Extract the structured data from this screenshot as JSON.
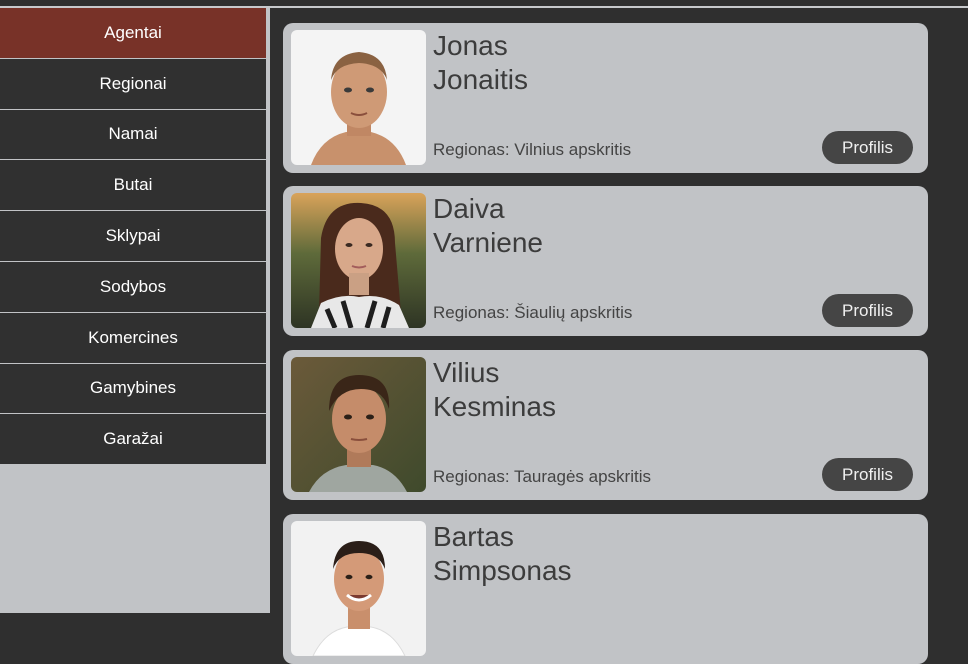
{
  "sidebar": {
    "items": [
      {
        "label": "Agentai",
        "active": true
      },
      {
        "label": "Regionai"
      },
      {
        "label": "Namai"
      },
      {
        "label": "Butai"
      },
      {
        "label": "Sklypai"
      },
      {
        "label": "Sodybos"
      },
      {
        "label": "Komercines"
      },
      {
        "label": "Gamybines"
      },
      {
        "label": "Garažai"
      }
    ]
  },
  "agents": [
    {
      "first": "Jonas",
      "last": "Jonaitis",
      "region": "Regionas: Vilnius apskritis",
      "button": "Profilis"
    },
    {
      "first": "Daiva",
      "last": "Varniene",
      "region": "Regionas: Šiaulių apskritis",
      "button": "Profilis"
    },
    {
      "first": "Vilius",
      "last": "Kesminas",
      "region": "Regionas: Tauragės apskritis",
      "button": "Profilis"
    },
    {
      "first": "Bartas",
      "last": "Simpsonas",
      "region": "",
      "button": ""
    }
  ],
  "colors": {
    "active_nav": "#783228",
    "nav_bg": "#303030",
    "card_bg": "#c1c3c6",
    "page_bg": "#2f2f2f",
    "button_bg": "#454545"
  }
}
